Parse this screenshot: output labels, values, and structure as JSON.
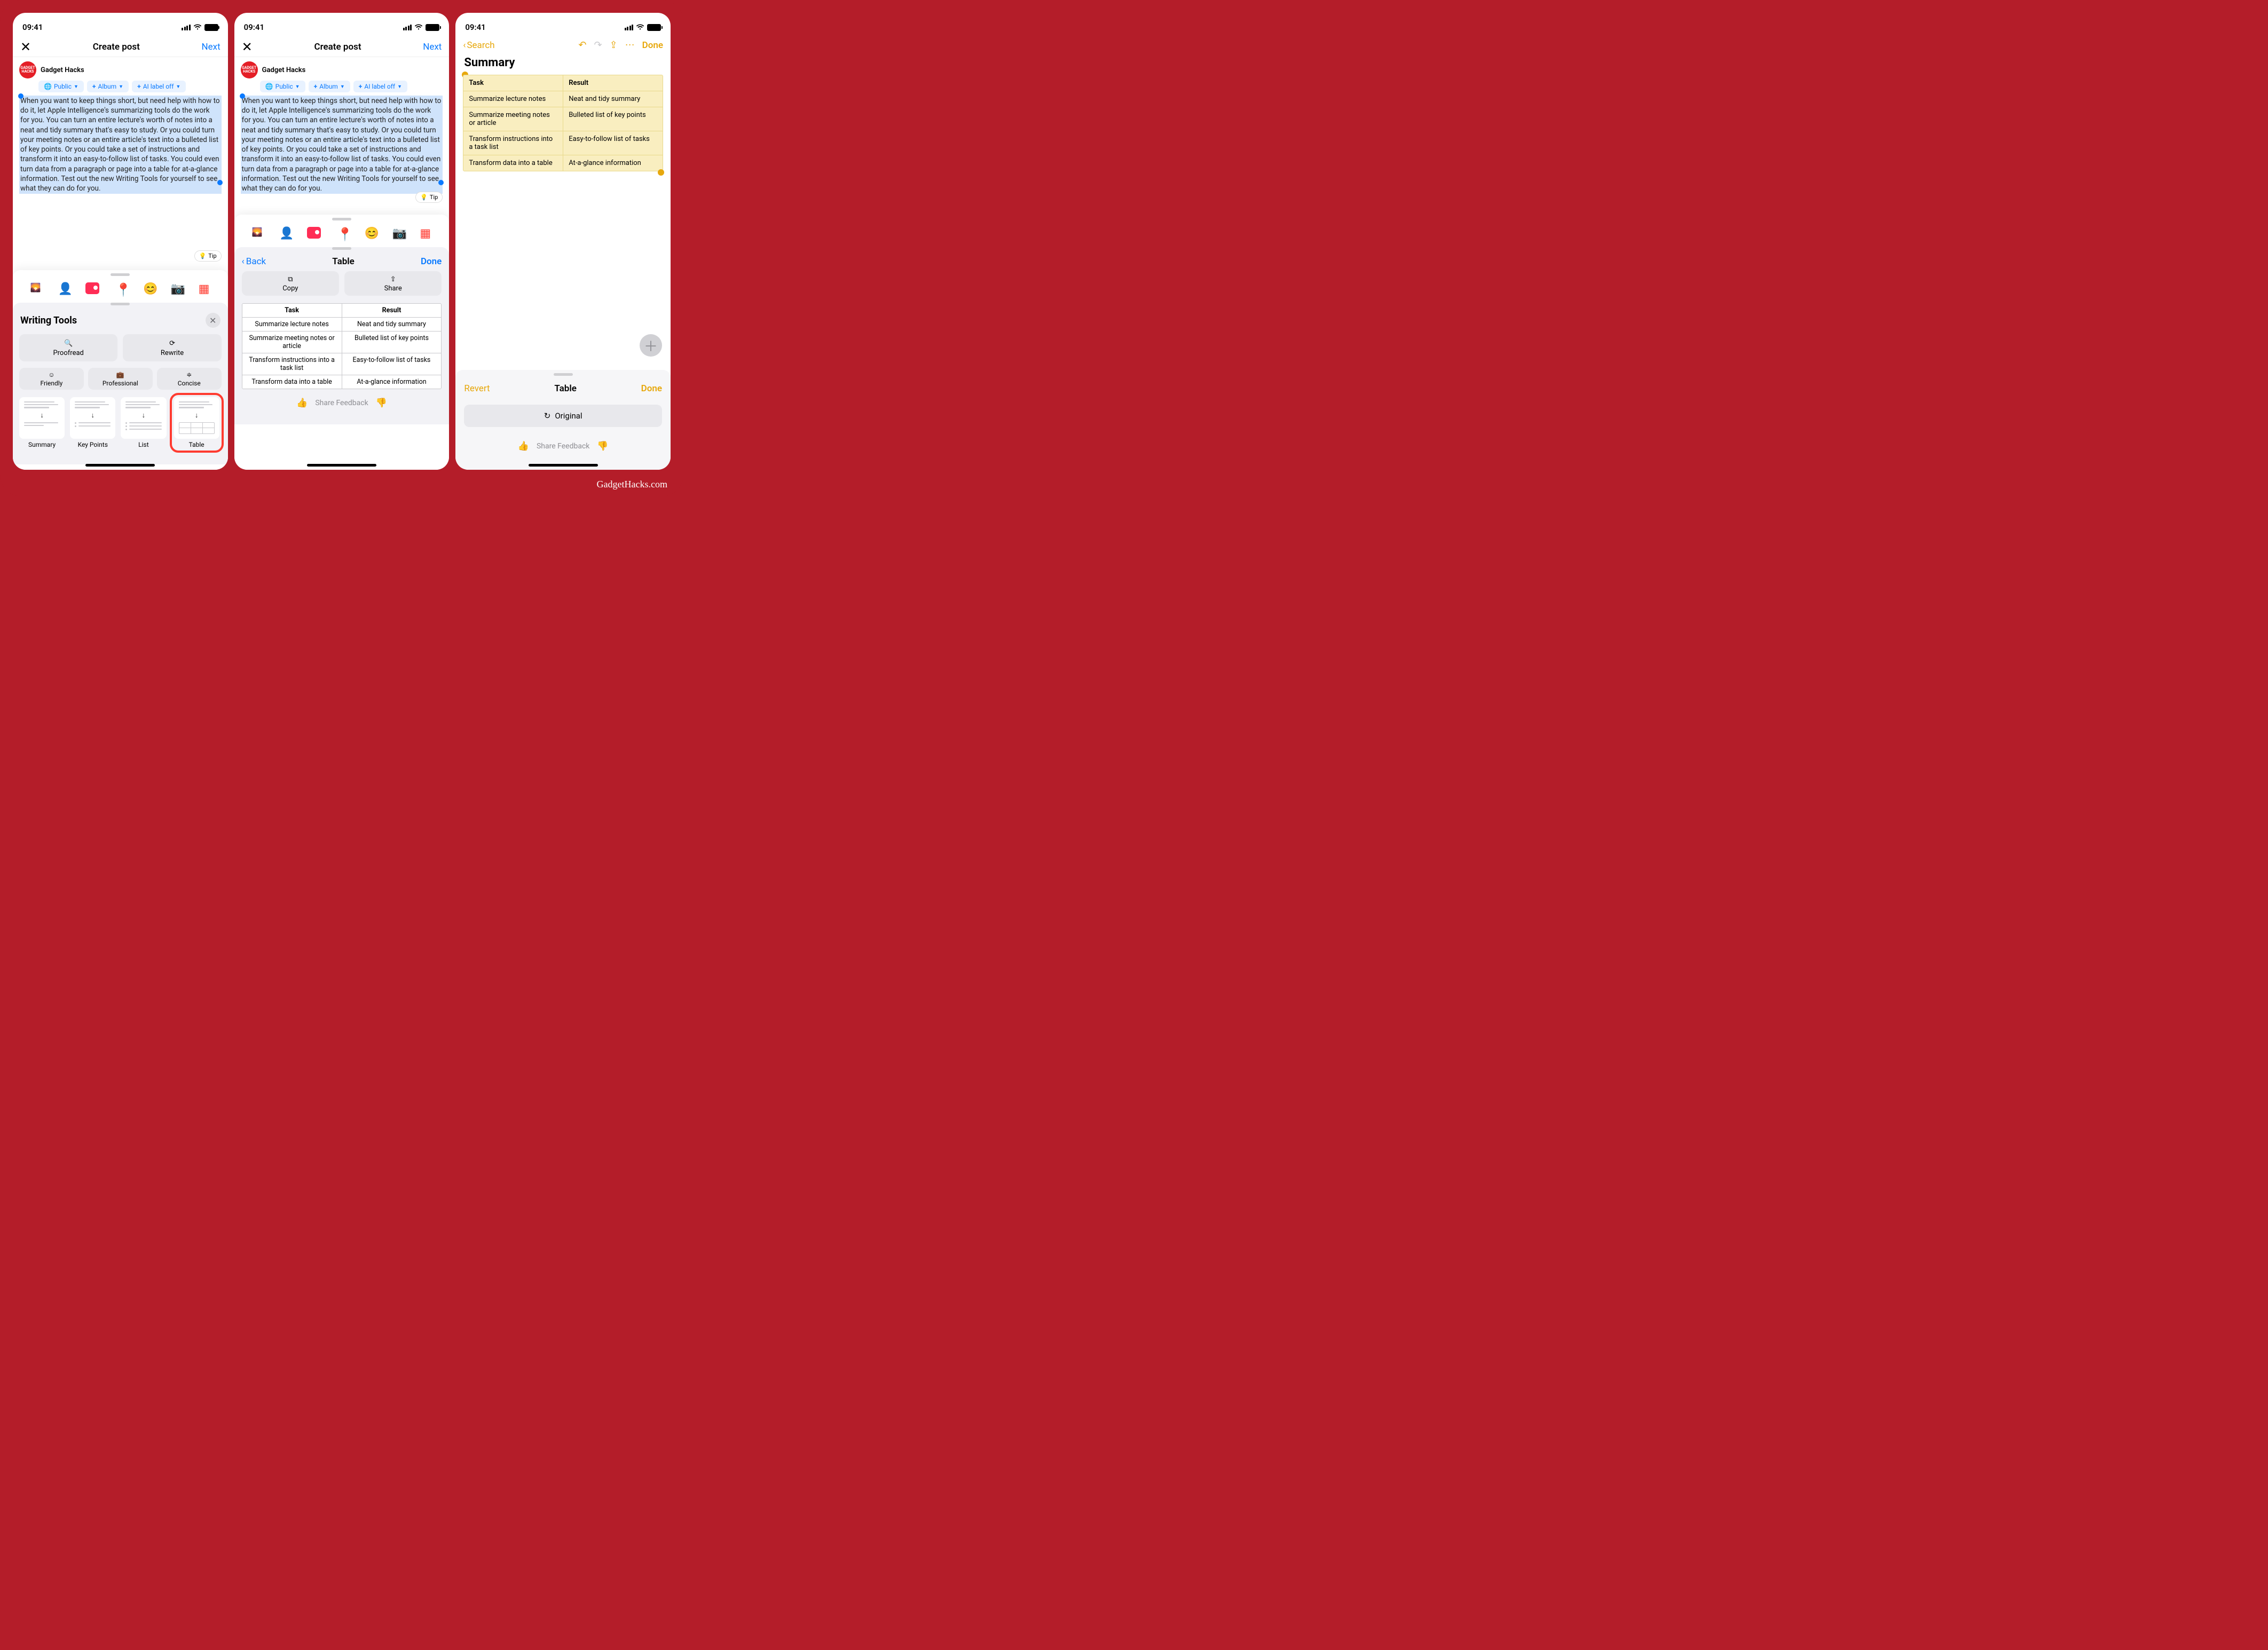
{
  "status": {
    "time": "09:41"
  },
  "phone1": {
    "nav": {
      "title": "Create post",
      "next": "Next"
    },
    "user": {
      "name": "Gadget Hacks",
      "avatar_text": "GADGET\nHACKS"
    },
    "pills": {
      "visibility": "Public",
      "album": "Album",
      "ai_label": "AI label off"
    },
    "post_text": "When you want to keep things short, but need help with how to do it, let Apple Intelligence's summarizing tools do the work for you. You can turn an entire lecture's worth of notes into a neat and tidy summary that's easy to study. Or you could turn your meeting notes or an entire article's text into a bulleted list of key points. Or you could take a set of instructions and transform it into an easy-to-follow list of tasks. You could even turn data from a paragraph or page into a table for at-a-glance information. Test out the new Writing Tools for yourself to see what they can do for you.",
    "tip": "Tip",
    "wt": {
      "title": "Writing Tools",
      "proofread": "Proofread",
      "rewrite": "Rewrite",
      "friendly": "Friendly",
      "professional": "Professional",
      "concise": "Concise",
      "summary": "Summary",
      "keypoints": "Key Points",
      "list": "List",
      "table": "Table"
    }
  },
  "phone2": {
    "nav": {
      "title": "Create post",
      "next": "Next"
    },
    "sub": {
      "back": "Back",
      "title": "Table",
      "done": "Done"
    },
    "copy": "Copy",
    "share": "Share",
    "table": {
      "headers": [
        "Task",
        "Result"
      ],
      "rows": [
        [
          "Summarize lecture notes",
          "Neat and tidy summary"
        ],
        [
          "Summarize meeting notes or article",
          "Bulleted list of key points"
        ],
        [
          "Transform instructions into a task list",
          "Easy-to-follow list of tasks"
        ],
        [
          "Transform data into a table",
          "At-a-glance information"
        ]
      ]
    },
    "feedback": "Share Feedback"
  },
  "phone3": {
    "back": "Search",
    "done": "Done",
    "title": "Summary",
    "table": {
      "headers": [
        "Task",
        "Result"
      ],
      "rows": [
        [
          "Summarize lecture notes",
          "Neat and tidy summary"
        ],
        [
          "Summarize meeting notes or article",
          "Bulleted list of key points"
        ],
        [
          "Transform instructions into a task list",
          "Easy-to-follow list of tasks"
        ],
        [
          "Transform data into a table",
          "At-a-glance information"
        ]
      ]
    },
    "sheet": {
      "revert": "Revert",
      "title": "Table",
      "done": "Done",
      "original": "Original",
      "feedback": "Share Feedback"
    }
  },
  "watermark": "GadgetHacks.com"
}
